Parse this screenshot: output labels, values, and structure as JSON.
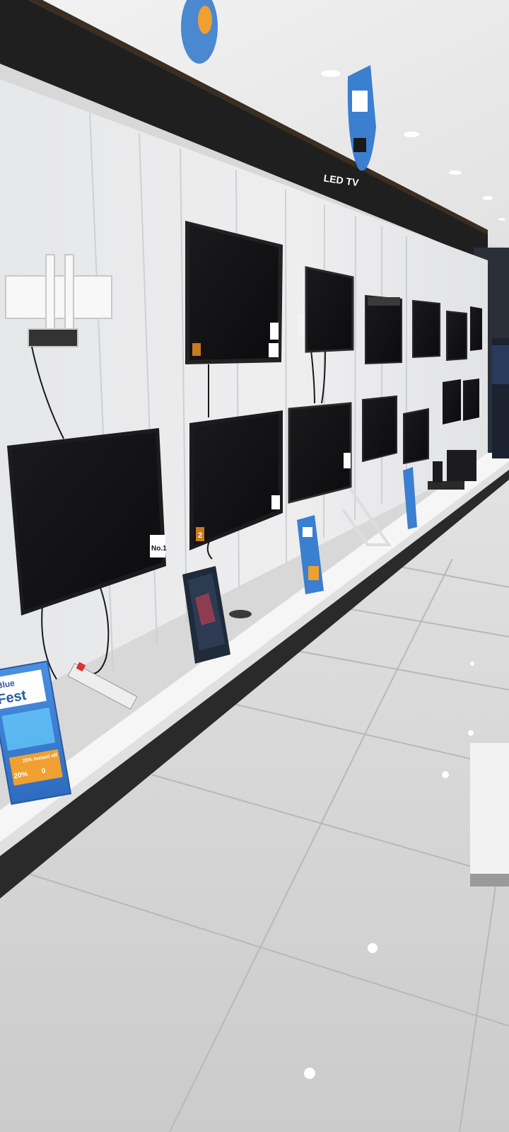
{
  "scene": {
    "fascia_sign": "LED TV",
    "promo": {
      "brand_line_1": "Blue",
      "brand_line_2": "Fest",
      "discount_1": "25% Instant off",
      "discount_2": "20%",
      "discount_3": "0"
    },
    "tv_badges": {
      "rank": "No.1",
      "warranty": "2"
    }
  },
  "colors": {
    "ceiling": "#ececec",
    "fascia": "#1e1e1e",
    "wall": "#e8e9ea",
    "floor": "#cfcfcf",
    "counter": "#f4f4f4",
    "tv_screen": "#121214",
    "promo_blue": "#3a7fd0",
    "promo_orange": "#f0a030"
  }
}
